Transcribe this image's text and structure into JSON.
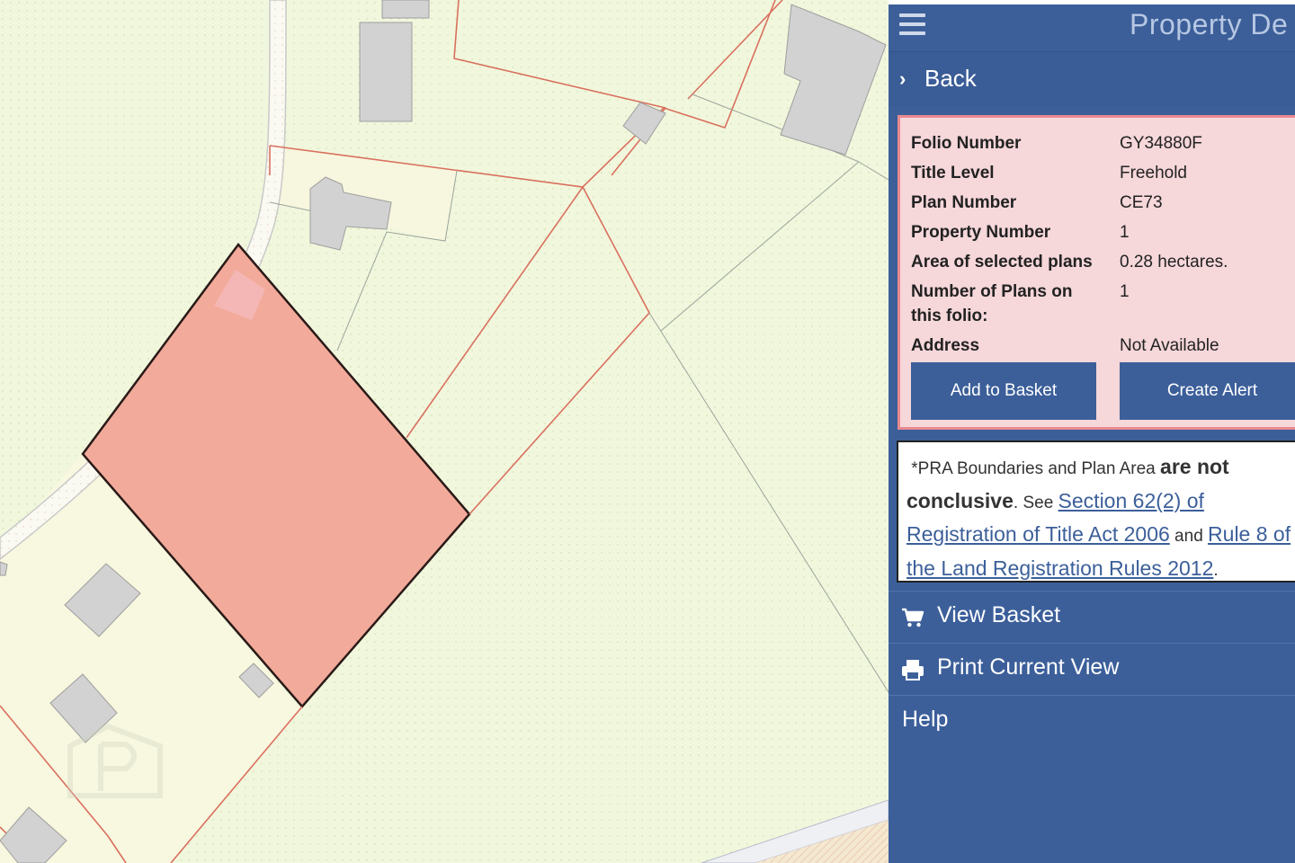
{
  "panel": {
    "title": "Property De",
    "menu_icon": "hamburger-menu-icon",
    "back_label": "Back",
    "back_icon": "chevron-right-icon"
  },
  "details": {
    "rows": [
      {
        "label": "Folio Number",
        "value": "GY34880F"
      },
      {
        "label": "Title Level",
        "value": "Freehold"
      },
      {
        "label": "Plan Number",
        "value": "CE73"
      },
      {
        "label": "Property Number",
        "value": "1"
      },
      {
        "label": "Area of selected plans",
        "value": "0.28 hectares."
      },
      {
        "label": "Number of Plans on this folio:",
        "value": "1"
      },
      {
        "label": "Address",
        "value": "Not Available"
      }
    ],
    "add_to_basket_label": "Add to Basket",
    "create_alert_label": "Create Alert"
  },
  "disclaimer": {
    "intro": "*PRA Boundaries and Plan Area ",
    "bold": "are not conclusive",
    "see": ". See ",
    "link1": "Section 62(2) of Registration of Title Act 2006",
    "and": " and ",
    "link2": "Rule 8 of the Land Registration Rules 2012",
    "end": "."
  },
  "menu": {
    "view_basket_label": "View Basket",
    "view_basket_icon": "shopping-cart-icon",
    "print_label": "Print Current View",
    "print_icon": "printer-icon",
    "help_label": "Help"
  },
  "map": {
    "watermark_icon": "property-logo-watermark",
    "colors": {
      "background": "#f1f7dd",
      "boundary": "#d9705e",
      "selected_fill": "#f2aa9b",
      "building": "#d2d2d2",
      "panel_blue": "#3c5f9a"
    }
  }
}
